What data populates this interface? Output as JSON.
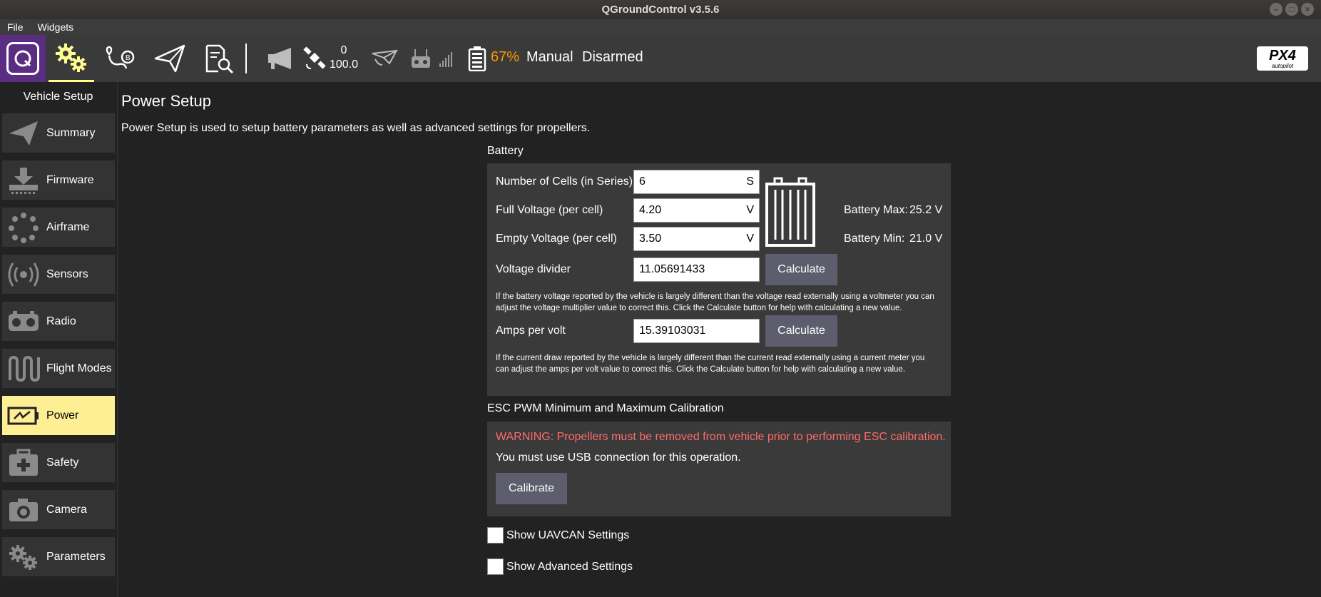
{
  "window": {
    "title": "QGroundControl v3.5.6"
  },
  "menu": {
    "file": "File",
    "widgets": "Widgets"
  },
  "toolbar": {
    "gps_count": "0",
    "gps_hdop": "100.0",
    "battery_percent": "67%",
    "flight_mode": "Manual",
    "arm_state": "Disarmed",
    "brand_big": "PX4",
    "brand_small": "autopilot",
    "colors": {
      "logo_bg": "#5a2d82",
      "active_accent": "#ffff90",
      "battery": "#ff9800"
    }
  },
  "sidebar": {
    "title": "Vehicle Setup",
    "items": [
      {
        "label": "Summary",
        "icon": "paper-plane-icon"
      },
      {
        "label": "Firmware",
        "icon": "download-icon"
      },
      {
        "label": "Airframe",
        "icon": "airframe-icon"
      },
      {
        "label": "Sensors",
        "icon": "sensors-icon"
      },
      {
        "label": "Radio",
        "icon": "radio-icon"
      },
      {
        "label": "Flight Modes",
        "icon": "waveform-icon"
      },
      {
        "label": "Power",
        "icon": "battery-icon"
      },
      {
        "label": "Safety",
        "icon": "first-aid-icon"
      },
      {
        "label": "Camera",
        "icon": "camera-icon"
      },
      {
        "label": "Parameters",
        "icon": "gears-icon"
      }
    ],
    "active": "Power",
    "active_color": "#ffef94"
  },
  "page": {
    "title": "Power Setup",
    "description": "Power Setup is used to setup battery parameters as well as advanced settings for propellers."
  },
  "battery": {
    "section_label": "Battery",
    "cells_label": "Number of Cells (in Series)",
    "cells_value": "6",
    "cells_unit": "S",
    "full_label": "Full Voltage (per cell)",
    "full_value": "4.20",
    "full_unit": "V",
    "empty_label": "Empty Voltage (per cell)",
    "empty_value": "3.50",
    "empty_unit": "V",
    "max_label": "Battery Max:",
    "max_value": "25.2 V",
    "min_label": "Battery Min:",
    "min_value": "21.0 V",
    "divider_label": "Voltage divider",
    "divider_value": "11.05691433",
    "calculate_label": "Calculate",
    "divider_help_1": "If the battery voltage reported by the vehicle is largely different than the voltage read externally using a voltmeter you can",
    "divider_help_2": "adjust the voltage multiplier value to correct this. Click the Calculate button for help with calculating a new value.",
    "amps_label": "Amps per volt",
    "amps_value": "15.39103031",
    "amps_help_1": "If the current draw reported by the vehicle is largely different than the current read externally using a current meter you",
    "amps_help_2": "can adjust the amps per volt value to correct this. Click the Calculate button for help with calculating a new value."
  },
  "esc": {
    "section_label": "ESC PWM Minimum and Maximum Calibration",
    "warning": "WARNING: Propellers must be removed from vehicle prior to performing ESC calibration.",
    "usb_note": "You must use USB connection for this operation.",
    "calibrate_label": "Calibrate",
    "warning_color": "#ff6a6a"
  },
  "options": {
    "uavcan_label": "Show UAVCAN Settings",
    "advanced_label": "Show Advanced Settings"
  }
}
